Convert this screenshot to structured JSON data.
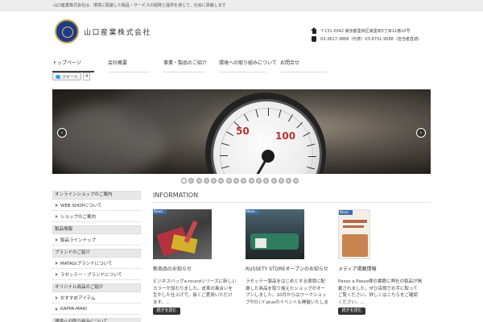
{
  "topbar": {
    "text": "山口産業株式会社は、環境に配慮した製品・サービスの開発と提供を通じて、社会に貢献します"
  },
  "logo": {
    "name": "山口産業株式会社"
  },
  "contact": {
    "address": "〒131-0042 東京都墨田区東墨田3丁目11番10号",
    "phone": "03-3617-3868（代表）03-6751-9588（担当者直通）"
  },
  "nav": {
    "items": [
      {
        "label": "トップページ"
      },
      {
        "label": "会社概要"
      },
      {
        "label": "事業・製品のご紹介"
      },
      {
        "label": "環境への取り組みについて"
      },
      {
        "label": "お問合せ"
      }
    ]
  },
  "tweet": {
    "label": "ツイート",
    "count": "4"
  },
  "slider": {
    "gauge_labels": [
      "50",
      "100"
    ],
    "prev_glyph": "‹",
    "next_glyph": "›",
    "dot_count": 16,
    "active_dot": 0
  },
  "sidebar": {
    "sections": [
      {
        "heading": "オンラインショップのご案内",
        "items": [
          "WEB SHOPについて",
          "ショップのご案内"
        ]
      },
      {
        "heading": "製品情報",
        "items": [
          "製品ラインナップ"
        ]
      },
      {
        "heading": "ブランドのご紹介",
        "items": [
          "MATAGIブランドについて",
          "ラセッテー・ブランドについて"
        ]
      },
      {
        "heading": "オリジナル商品のご紹介",
        "items": [
          "おすすめアイテム",
          "KAPPA-MAKI"
        ]
      },
      {
        "heading": "環境への取り組みについて",
        "items": []
      }
    ]
  },
  "information": {
    "title": "INFORMATION",
    "news_tag": "News",
    "more_label": "続きを読む",
    "cards": [
      {
        "title": "新商品のお知らせ",
        "body": "ビジネスバッグa-roundシリーズに新しいカラーが加わりました。皮革の風合いを生かした仕上げで、長くご愛用いただけます。..."
      },
      {
        "title": "RUSSETY STOREオープンのお知らせ",
        "body": "ラセッテー製品をはじめとする環境に配慮した商品を取り揃えたショップがオープンしました。10月からはワークショップやD.I.Y plusのイベントも開催いたします。ぜひお気軽にお立ち寄りください。..."
      },
      {
        "title": "メディア掲載情報",
        "body": "Passo a Passo様の書籍に弊社の製品が掲載されました。ぜひ店頭でお手に取ってご覧ください。詳しくはこちらをご確認ください。..."
      }
    ]
  }
}
